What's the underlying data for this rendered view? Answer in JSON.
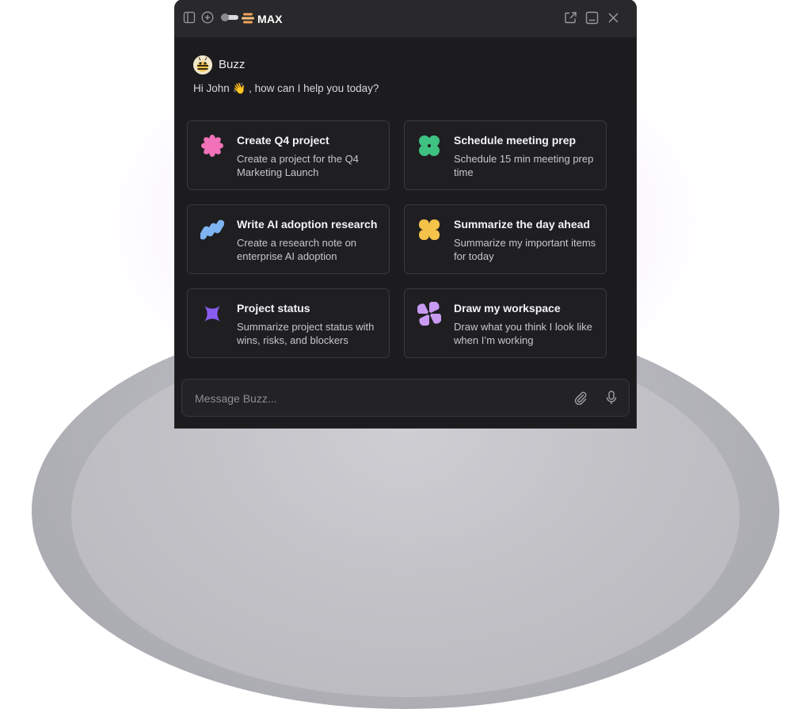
{
  "window": {
    "brand_label": "MAX",
    "controls": [
      "sidebar-toggle-icon",
      "new-chat-icon",
      "open-external-icon",
      "minimize-icon",
      "close-icon"
    ]
  },
  "assistant": {
    "name": "Buzz",
    "greeting": "Hi John 👋 , how can I help you today?"
  },
  "cards": [
    {
      "title": "Create Q4 project",
      "description": "Create a project for the Q4 Marketing Launch",
      "icon": "flower-icon",
      "color": "#f272b9"
    },
    {
      "title": "Schedule meeting prep",
      "description": "Schedule 15 min meeting prep time",
      "icon": "clover-icon",
      "color": "#3ec281"
    },
    {
      "title": "Write AI adoption research",
      "description": "Create a research note on enterprise AI adoption",
      "icon": "wave-icon",
      "color": "#7fb4f2"
    },
    {
      "title": "Summarize the day ahead",
      "description": "Summarize my important items for today",
      "icon": "quatrefoil-icon",
      "color": "#f5c24a"
    },
    {
      "title": "Project status",
      "description": "Summarize project status with wins, risks, and blockers",
      "icon": "sparkle-icon",
      "color": "#8a5cf0"
    },
    {
      "title": "Draw my workspace",
      "description": "Draw what you think I look like when I’m working",
      "icon": "pinwheel-icon",
      "color": "#c99af2"
    }
  ],
  "composer": {
    "placeholder": "Message Buzz..."
  }
}
